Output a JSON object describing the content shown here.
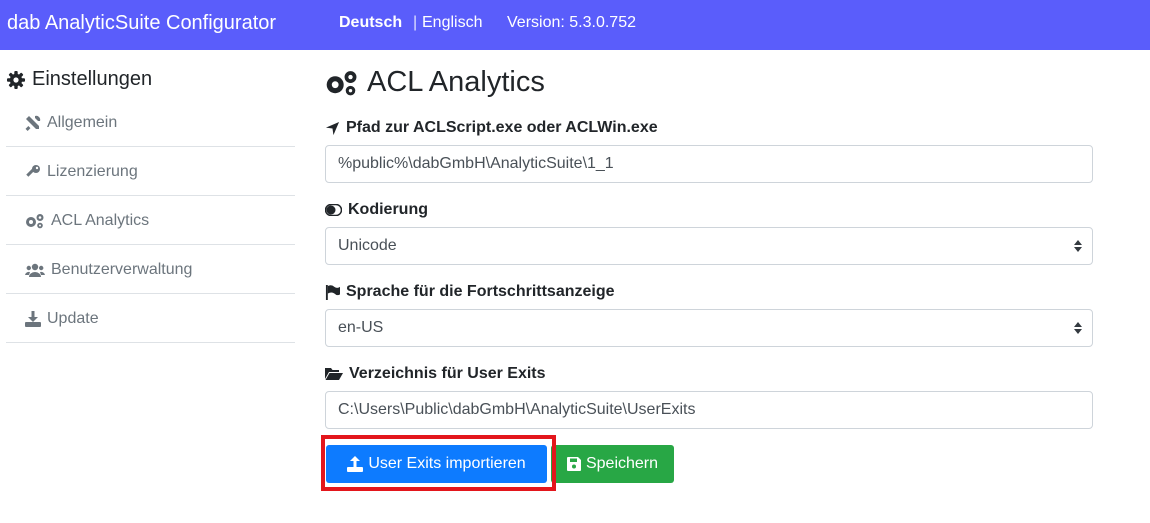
{
  "header": {
    "title": "dab AnalyticSuite Configurator",
    "lang_de": "Deutsch",
    "separator": "|",
    "lang_en": "Englisch",
    "version": "Version: 5.3.0.752",
    "bg_color": "#5a5dfb"
  },
  "sidebar": {
    "title": "Einstellungen",
    "title_icon": "gear-icon",
    "items": [
      {
        "label": "Allgemein",
        "icon": "tools-icon"
      },
      {
        "label": "Lizenzierung",
        "icon": "key-icon"
      },
      {
        "label": "ACL Analytics",
        "icon": "gears-icon"
      },
      {
        "label": "Benutzerverwaltung",
        "icon": "users-icon"
      },
      {
        "label": "Update",
        "icon": "download-icon"
      }
    ]
  },
  "main": {
    "title": "ACL Analytics",
    "title_icon": "gears-icon",
    "fields": [
      {
        "label": "Pfad zur ACLScript.exe oder ACLWin.exe",
        "icon": "location-arrow-icon",
        "value": "%public%\\dabGmbH\\AnalyticSuite\\1_1",
        "type": "text"
      },
      {
        "label": "Kodierung",
        "icon": "toggle-icon",
        "value": "Unicode",
        "type": "select"
      },
      {
        "label": "Sprache für die Fortschrittsanzeige",
        "icon": "flag-icon",
        "value": "en-US",
        "type": "select"
      },
      {
        "label": "Verzeichnis für User Exits",
        "icon": "folder-open-icon",
        "value": "C:\\Users\\Public\\dabGmbH\\AnalyticSuite\\UserExits",
        "type": "text"
      }
    ],
    "buttons": {
      "import_label": "User Exits importieren",
      "save_label": "Speichern",
      "import_color": "#0d7bff",
      "save_color": "#28a745",
      "highlight_color": "#e3161c"
    }
  }
}
